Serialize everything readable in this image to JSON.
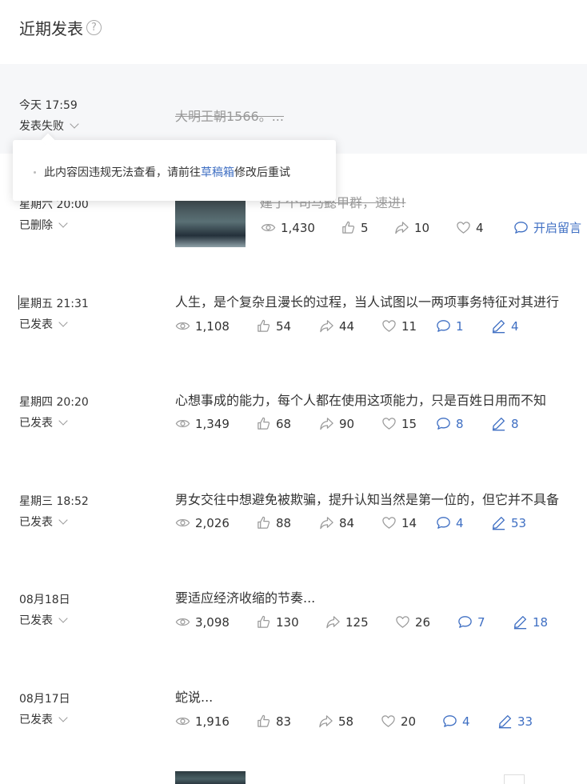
{
  "page": {
    "title": "近期发表",
    "help_glyph": "?"
  },
  "tooltip": {
    "text_before": "此内容因违规无法查看，请前往",
    "link": "草稿箱",
    "text_after": "修改后重试"
  },
  "posts": [
    {
      "time": "今天 17:59",
      "status": "发表失败",
      "title": "大明王朝1566。..."
    },
    {
      "time": "星期六 20:00",
      "status": "已删除",
      "title": "建了个司马懿甲群，速进!",
      "stats": {
        "views": "1,430",
        "likes": "5",
        "shares": "10",
        "favs": "4",
        "comment_label": "开启留言"
      }
    },
    {
      "time": "星期五 21:31",
      "status": "已发表",
      "title": "人生，是个复杂且漫长的过程，当人试图以一两项事务特征对其进行",
      "stats": {
        "views": "1,108",
        "likes": "54",
        "shares": "44",
        "favs": "11",
        "comments": "1",
        "edits": "4"
      }
    },
    {
      "time": "星期四 20:20",
      "status": "已发表",
      "title": "心想事成的能力，每个人都在使用这项能力，只是百姓日用而不知",
      "stats": {
        "views": "1,349",
        "likes": "68",
        "shares": "90",
        "favs": "15",
        "comments": "8",
        "edits": "8"
      }
    },
    {
      "time": "星期三 18:52",
      "status": "已发表",
      "title": "男女交往中想避免被欺骗，提升认知当然是第一位的，但它并不具备",
      "stats": {
        "views": "2,026",
        "likes": "88",
        "shares": "84",
        "favs": "14",
        "comments": "4",
        "edits": "53"
      }
    },
    {
      "time": "08月18日",
      "status": "已发表",
      "title": "要适应经济收缩的节奏...",
      "stats": {
        "views": "3,098",
        "likes": "130",
        "shares": "125",
        "favs": "26",
        "comments": "7",
        "edits": "18"
      }
    },
    {
      "time": "08月17日",
      "status": "已发表",
      "title": "蛇说...",
      "stats": {
        "views": "1,916",
        "likes": "83",
        "shares": "58",
        "favs": "20",
        "comments": "4",
        "edits": "33"
      }
    }
  ],
  "colors": {
    "accent": "#3f6fc3",
    "muted": "#999999",
    "failed_bg": "#f6f7f9"
  },
  "icons": [
    "help-icon",
    "chevron-down-icon",
    "eye-icon",
    "thumbs-up-icon",
    "share-icon",
    "heart-icon",
    "comment-icon",
    "pencil-icon"
  ]
}
